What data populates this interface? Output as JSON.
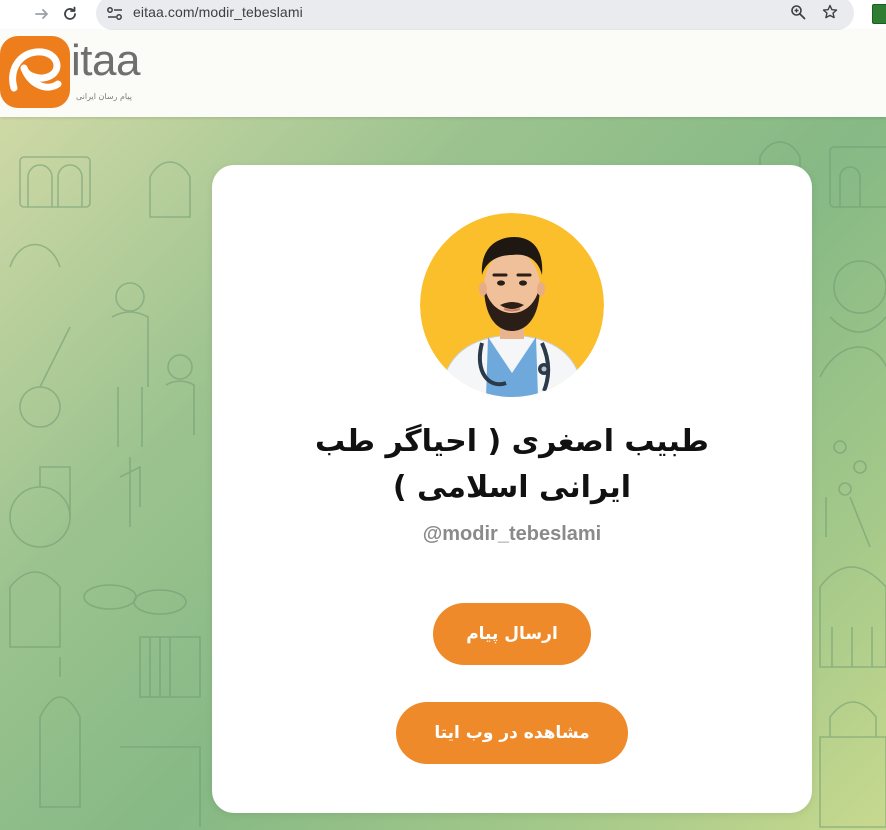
{
  "browser": {
    "url": "eitaa.com/modir_tebeslami",
    "icons": [
      "back-icon",
      "forward-icon",
      "reload-icon",
      "site-info-icon",
      "zoom-icon",
      "bookmark-star-icon",
      "extension-icon"
    ]
  },
  "header": {
    "logo_word": "itaa",
    "logo_tagline": "پیام رسان ایرانی",
    "brand_color": "#ee7d1c"
  },
  "profile": {
    "name": "طبیب اصغری ( احیاگر طب ایرانی اسلامی )",
    "username": "@modir_tebeslami",
    "avatar_icon": "doctor-avatar"
  },
  "actions": {
    "send_message": "ارسال پیام",
    "view_web": "مشاهده در وب ایتا"
  },
  "colors": {
    "button": "#ee8a2a",
    "avatar_bg": "#fbbf2b",
    "bg_green": "#86b985"
  }
}
